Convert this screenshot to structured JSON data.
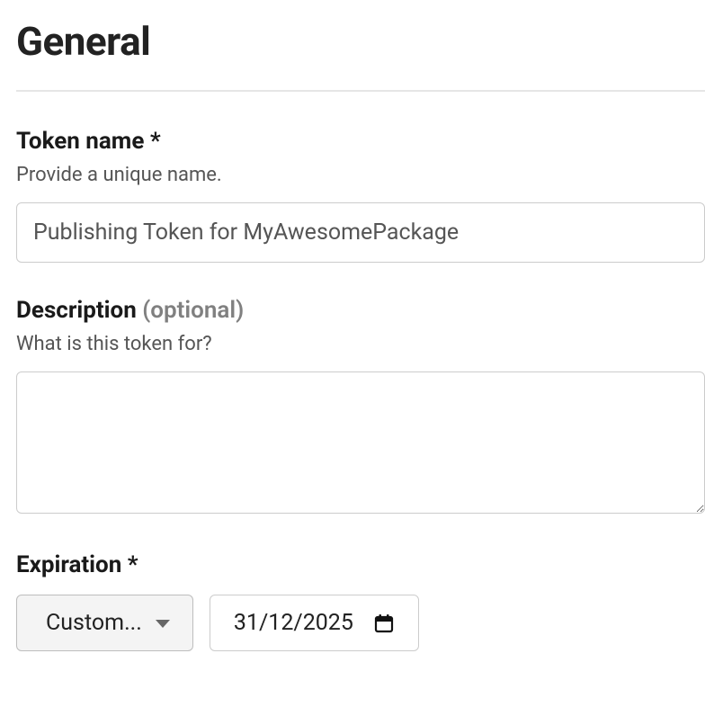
{
  "section": {
    "title": "General"
  },
  "tokenName": {
    "label": "Token name *",
    "help": "Provide a unique name.",
    "value": "Publishing Token for MyAwesomePackage"
  },
  "description": {
    "label": "Description ",
    "optional": "(optional)",
    "help": "What is this token for?",
    "value": ""
  },
  "expiration": {
    "label": "Expiration *",
    "selectLabel": "Custom...",
    "dateValue": "31/12/2025"
  }
}
